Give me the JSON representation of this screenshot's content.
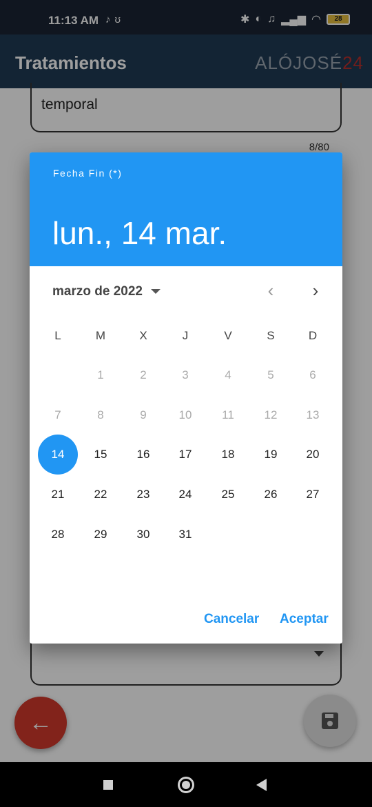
{
  "status_bar": {
    "time": "11:13 AM",
    "left_icons": [
      "tiktok-icon",
      "rabbit-icon"
    ],
    "right_icons": [
      "bluetooth-icon",
      "toggle-icon",
      "mute-icon",
      "signal-icon",
      "wifi-icon",
      "battery-icon"
    ],
    "battery": "28"
  },
  "app_bar": {
    "title": "Tratamientos",
    "brand": "ALÓJOSÉ",
    "brand_number": "24"
  },
  "form": {
    "top_field_value": "temporal",
    "char_counter": "8/80"
  },
  "date_picker": {
    "help_text": "Fecha Fin (*)",
    "selected_date": "lun., 14 mar.",
    "month_year": "marzo de 2022",
    "weekdays": [
      "L",
      "M",
      "X",
      "J",
      "V",
      "S",
      "D"
    ],
    "weeks": [
      [
        "",
        "1",
        "2",
        "3",
        "4",
        "5",
        "6"
      ],
      [
        "7",
        "8",
        "9",
        "10",
        "11",
        "12",
        "13"
      ],
      [
        "14",
        "15",
        "16",
        "17",
        "18",
        "19",
        "20"
      ],
      [
        "21",
        "22",
        "23",
        "24",
        "25",
        "26",
        "27"
      ],
      [
        "28",
        "29",
        "30",
        "31",
        "",
        "",
        ""
      ]
    ],
    "disabled_through": 13,
    "selected_day": "14",
    "cancel_label": "Cancelar",
    "accept_label": "Aceptar"
  },
  "colors": {
    "accent": "#2196f3",
    "app_bar": "#1f3a55",
    "fab_back": "#d2392c"
  }
}
